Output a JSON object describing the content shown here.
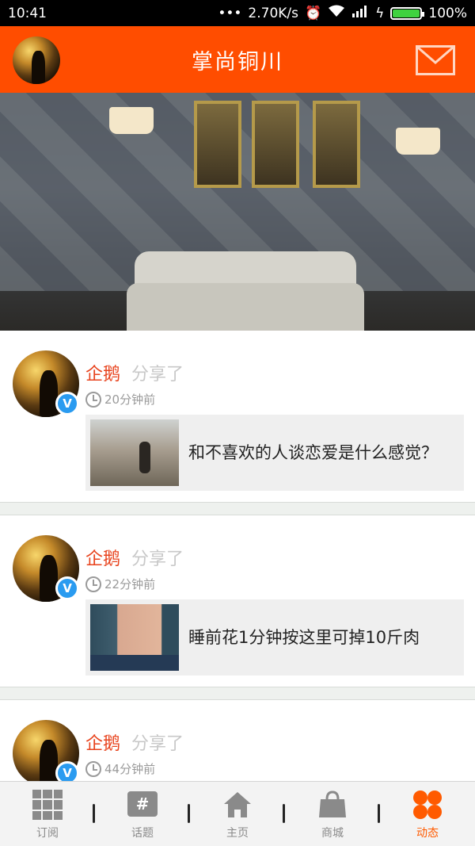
{
  "status_bar": {
    "time": "10:41",
    "network_dots": "•••",
    "speed": "2.70K/s",
    "battery": "100%"
  },
  "header": {
    "title": "掌尚铜川",
    "accent_color": "#ff4d00"
  },
  "banner": {
    "slide_count": 7,
    "active_slide_index": 2
  },
  "feed": {
    "posts": [
      {
        "user": "企鹅",
        "action": "分享了",
        "time": "20分钟前",
        "card_title": "和不喜欢的人谈恋爱是什么感觉？",
        "verified": true
      },
      {
        "user": "企鹅",
        "action": "分享了",
        "time": "22分钟前",
        "card_title": "睡前花1分钟按这里可掉10斤肉",
        "verified": true
      },
      {
        "user": "企鹅",
        "action": "分享了",
        "time": "44分钟前",
        "card_title": "",
        "verified": true
      }
    ]
  },
  "tabbar": {
    "tabs": [
      {
        "label": "订阅",
        "icon": "grid-icon",
        "active": false
      },
      {
        "label": "话题",
        "icon": "hashtag-icon",
        "active": false
      },
      {
        "label": "主页",
        "icon": "home-icon",
        "active": false
      },
      {
        "label": "商城",
        "icon": "shopping-bag-icon",
        "active": false
      },
      {
        "label": "动态",
        "icon": "flower-icon",
        "active": true
      }
    ],
    "active_color": "#ff5a00"
  }
}
